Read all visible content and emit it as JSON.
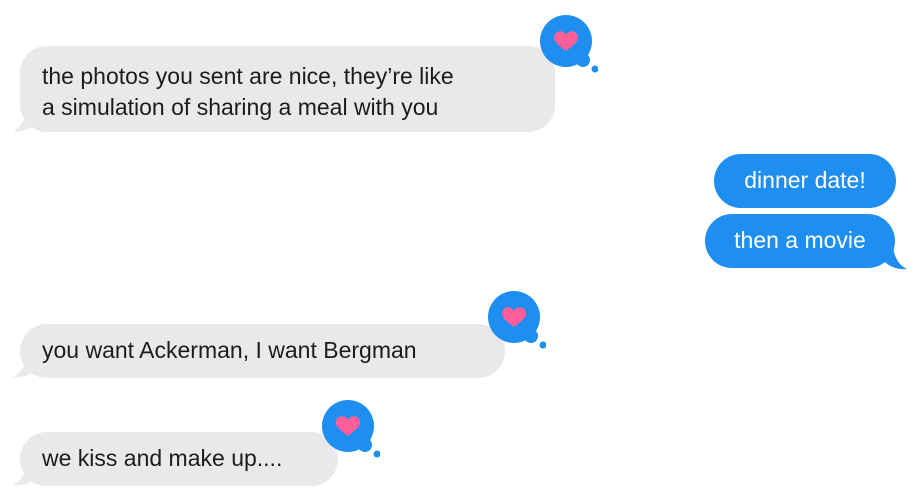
{
  "colors": {
    "incoming_bubble": "#e9e9eb",
    "incoming_text": "#1c1c1e",
    "outgoing_bubble": "#1f8ef1",
    "outgoing_text": "#ffffff",
    "tapback_background": "#1f8ef1",
    "heart": "#ff5f99",
    "page_background": "#ffffff"
  },
  "messages": [
    {
      "direction": "incoming",
      "lines": [
        "the photos you sent are nice, they’re like",
        "a simulation of sharing a meal with you"
      ],
      "tapback": "heart-icon"
    },
    {
      "direction": "outgoing",
      "lines": [
        "dinner date!"
      ]
    },
    {
      "direction": "outgoing",
      "lines": [
        "then a movie"
      ]
    },
    {
      "direction": "incoming",
      "lines": [
        "you want Ackerman, I want Bergman"
      ],
      "tapback": "heart-icon"
    },
    {
      "direction": "incoming",
      "lines": [
        "we kiss and make up...."
      ],
      "tapback": "heart-icon"
    }
  ]
}
